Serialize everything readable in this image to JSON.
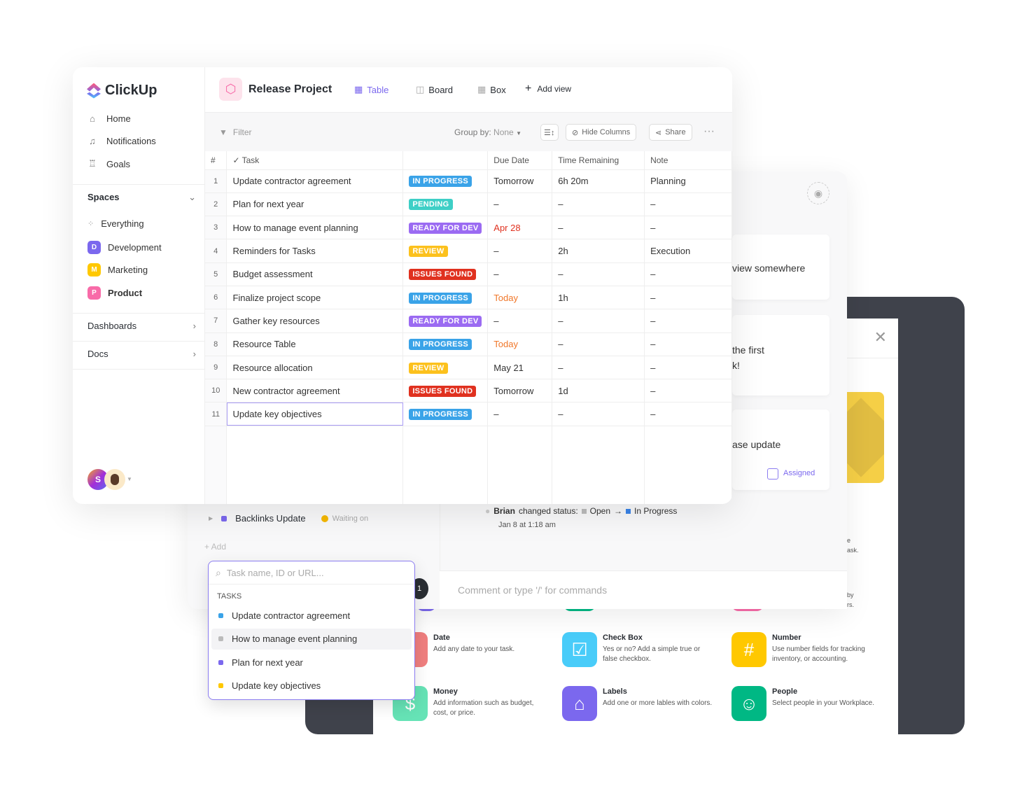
{
  "app": {
    "logo": "ClickUp",
    "project": "Release Project"
  },
  "views": [
    {
      "label": "Table",
      "active": true
    },
    {
      "label": "Board"
    },
    {
      "label": "Box"
    },
    {
      "label": "Add view"
    }
  ],
  "sidebar": {
    "nav": [
      {
        "label": "Home",
        "icon": "home-icon"
      },
      {
        "label": "Notifications",
        "icon": "bell-icon"
      },
      {
        "label": "Goals",
        "icon": "trophy-icon"
      }
    ],
    "spaces_label": "Spaces",
    "everything": "Everything",
    "spaces": [
      {
        "letter": "D",
        "label": "Development",
        "color": "#7b68ee"
      },
      {
        "letter": "M",
        "label": "Marketing",
        "color": "#ffc800"
      },
      {
        "letter": "P",
        "label": "Product",
        "color": "#f86ba8"
      }
    ],
    "dashboards": "Dashboards",
    "docs": "Docs",
    "avatar_letter": "S"
  },
  "toolbar": {
    "filter": "Filter",
    "group_by_label": "Group by:",
    "group_by_value": "None",
    "hide_columns": "Hide Columns",
    "share": "Share"
  },
  "table": {
    "columns": [
      "#",
      "Task",
      "",
      "Due Date",
      "Time Remaining",
      "Note"
    ],
    "status_colors": {
      "IN PROGRESS": "#3aa3e8",
      "PENDING": "#3ecfc6",
      "READY FOR DEV": "#9b6bf2",
      "REVIEW": "#fcc11d",
      "ISSUES FOUND": "#e0311f"
    },
    "rows": [
      {
        "n": "1",
        "task": "Update contractor agreement",
        "status": "IN PROGRESS",
        "due": "Tomorrow",
        "time": "6h 20m",
        "note": "Planning"
      },
      {
        "n": "2",
        "task": "Plan for next year",
        "status": "PENDING",
        "due": "–",
        "time": "–",
        "note": "–"
      },
      {
        "n": "3",
        "task": "How to manage event planning",
        "status": "READY FOR DEV",
        "due": "Apr 28",
        "due_color": "#e0311f",
        "time": "–",
        "note": "–"
      },
      {
        "n": "4",
        "task": "Reminders for Tasks",
        "status": "REVIEW",
        "due": "–",
        "time": "2h",
        "note": "Execution"
      },
      {
        "n": "5",
        "task": "Budget assessment",
        "status": "ISSUES FOUND",
        "due": "–",
        "time": "–",
        "note": "–"
      },
      {
        "n": "6",
        "task": "Finalize project scope",
        "status": "IN PROGRESS",
        "due": "Today",
        "due_color": "#f0772a",
        "time": "1h",
        "note": "–"
      },
      {
        "n": "7",
        "task": "Gather key resources",
        "status": "READY FOR DEV",
        "due": "–",
        "time": "–",
        "note": "–"
      },
      {
        "n": "8",
        "task": "Resource Table",
        "status": "IN PROGRESS",
        "due": "Today",
        "due_color": "#f0772a",
        "time": "–",
        "note": "–"
      },
      {
        "n": "9",
        "task": "Resource allocation",
        "status": "REVIEW",
        "due": "May 21",
        "time": "–",
        "note": "–"
      },
      {
        "n": "10",
        "task": "New contractor agreement",
        "status": "ISSUES FOUND",
        "due": "Tomorrow",
        "time": "1d",
        "note": "–"
      },
      {
        "n": "11",
        "task": "Update key objectives",
        "status": "IN PROGRESS",
        "due": "–",
        "time": "–",
        "note": "–"
      }
    ]
  },
  "detail": {
    "subtask": "Backlinks Update",
    "subtask_status": "Waiting on",
    "add": "+ Add",
    "activity": {
      "user": "Brian",
      "action": "changed status:",
      "from": "Open",
      "to": "In Progress",
      "time": "Jan 8 at 1:18 am"
    },
    "comment_placeholder": "Comment or type '/' for commands",
    "cards": [
      "view somewhere",
      "the first",
      "k!",
      "ase update"
    ],
    "assigned": "Assigned",
    "fragments": [
      "e",
      "ask.",
      "by",
      "rs."
    ],
    "badge_count": "1"
  },
  "search": {
    "placeholder": "Task name, ID or URL...",
    "section": "TASKS",
    "items": [
      {
        "label": "Update contractor agreement",
        "color": "#3aa3e8"
      },
      {
        "label": "How to manage event planning",
        "color": "#bbbbbb"
      },
      {
        "label": "Plan for next year",
        "color": "#7b68ee"
      },
      {
        "label": "Update key objectives",
        "color": "#ffc800"
      }
    ]
  },
  "fields": [
    {
      "title": "Date",
      "desc": "Add any date to your task.",
      "color": "#f07f7f",
      "icon": "calendar-icon",
      "glyph": "▯"
    },
    {
      "title": "Check Box",
      "desc": "Yes or no? Add a simple true or false checkbox.",
      "color": "#49ccf9",
      "icon": "checkbox-icon",
      "glyph": "☑"
    },
    {
      "title": "Number",
      "desc": "Use number fields for tracking inventory, or accounting.",
      "color": "#ffc800",
      "icon": "hash-icon",
      "glyph": "#"
    },
    {
      "title": "Money",
      "desc": "Add information such as budget, cost, or price.",
      "color": "#66e3b6",
      "icon": "money-icon",
      "glyph": "$"
    },
    {
      "title": "Labels",
      "desc": "Add one or more lables with colors.",
      "color": "#7b68ee",
      "icon": "tag-icon",
      "glyph": "⌂"
    },
    {
      "title": "People",
      "desc": "Select people in your Workplace.",
      "color": "#00b884",
      "icon": "people-icon",
      "glyph": "☺"
    }
  ]
}
